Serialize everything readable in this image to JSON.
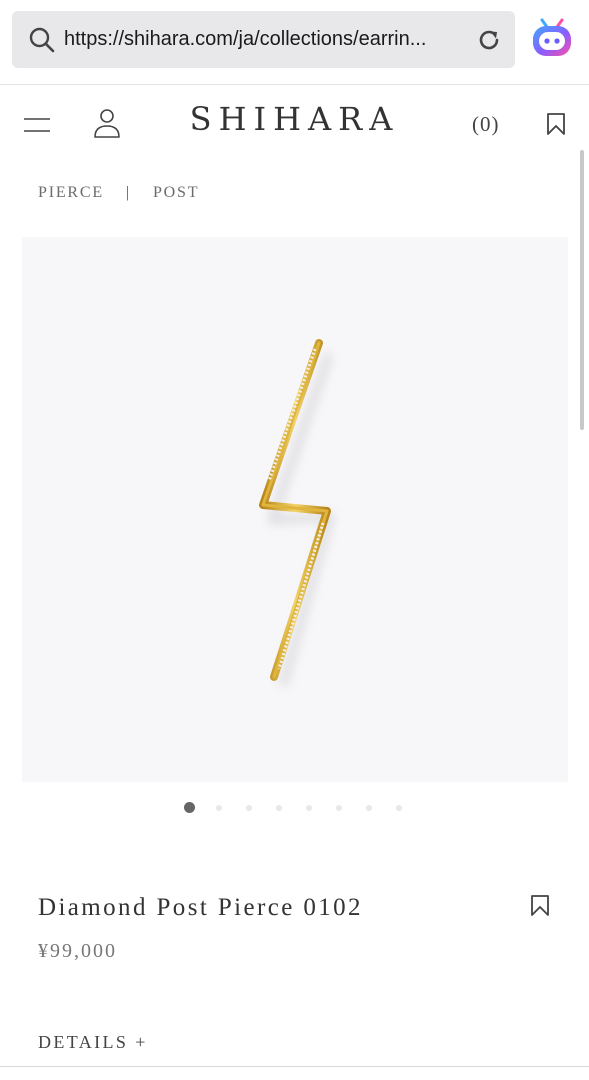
{
  "browser": {
    "url": "https://shihara.com/ja/collections/earrin...",
    "icons": {
      "search": "search-icon",
      "reload": "reload-icon",
      "extension": "assistant-extension-icon"
    }
  },
  "header": {
    "logo": "SHIHARA",
    "cart_count": "(0)",
    "icons": {
      "menu": "menu-icon",
      "account": "account-icon",
      "wishlist": "bookmark-icon"
    }
  },
  "breadcrumb": {
    "items": [
      "PIERCE",
      "POST"
    ],
    "separator": "|"
  },
  "gallery": {
    "image_count": 8,
    "active_index": 0
  },
  "product": {
    "title": "Diamond Post Pierce 0102",
    "price": "¥99,000",
    "details_label": "DETAILS +"
  },
  "colors": {
    "gold": "#d4a62a",
    "image_bg": "#f7f7f9",
    "text": "#333333"
  }
}
